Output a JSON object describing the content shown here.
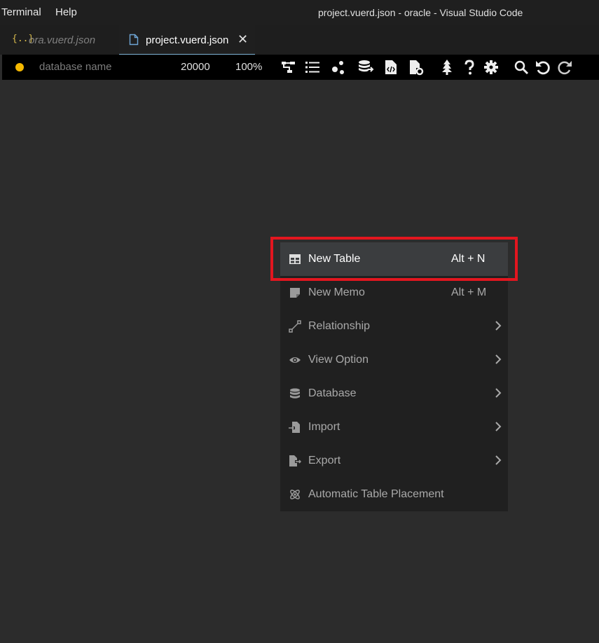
{
  "menubar": {
    "terminal": "Terminal",
    "help": "Help"
  },
  "window_title": "project.vuerd.json - oracle - Visual Studio Code",
  "tabs": [
    {
      "icon": "json-braces-icon",
      "glyph": "{..}",
      "label": "ora.vuerd.json",
      "active": false
    },
    {
      "icon": "file-icon",
      "label": "project.vuerd.json",
      "active": true,
      "close": "✕"
    }
  ],
  "toolbar": {
    "status_color": "#f5b800",
    "database_placeholder": "database name",
    "canvas_size": "20000",
    "zoom": "100%",
    "icons": [
      "diagram-icon",
      "list-icon",
      "relationship-dots-icon",
      "database-export-icon",
      "code-file-icon",
      "file-settings-icon",
      "tree-icon",
      "help-icon",
      "gear-icon",
      "search-icon",
      "undo-icon",
      "redo-icon"
    ]
  },
  "context_menu": {
    "items": [
      {
        "icon": "table-icon",
        "label": "New Table",
        "shortcut": "Alt + N",
        "submenu": false,
        "active": true
      },
      {
        "icon": "memo-icon",
        "label": "New Memo",
        "shortcut": "Alt + M",
        "submenu": false,
        "active": false
      },
      {
        "icon": "relationship-icon",
        "label": "Relationship",
        "shortcut": "",
        "submenu": true,
        "active": false
      },
      {
        "icon": "eye-icon",
        "label": "View Option",
        "shortcut": "",
        "submenu": true,
        "active": false
      },
      {
        "icon": "database-icon",
        "label": "Database",
        "shortcut": "",
        "submenu": true,
        "active": false
      },
      {
        "icon": "import-icon",
        "label": "Import",
        "shortcut": "",
        "submenu": true,
        "active": false
      },
      {
        "icon": "export-icon",
        "label": "Export",
        "shortcut": "",
        "submenu": true,
        "active": false
      },
      {
        "icon": "atom-icon",
        "label": "Automatic Table Placement",
        "shortcut": "",
        "submenu": false,
        "active": false
      }
    ]
  },
  "colors": {
    "highlight_border": "#e3161f",
    "accent_tab": "#7fb3d6"
  }
}
